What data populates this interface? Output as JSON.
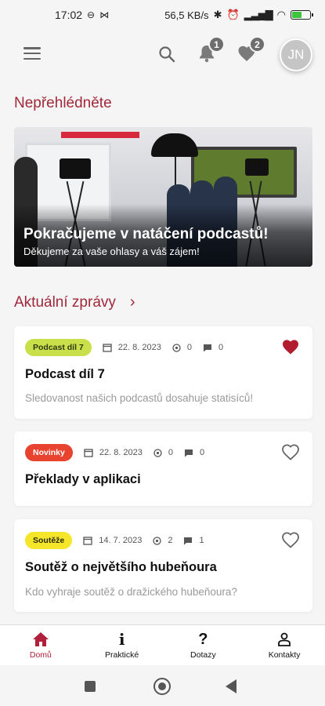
{
  "status_bar": {
    "time": "17:02",
    "network_speed": "56,5 KB/s",
    "battery_level": 0.55
  },
  "header": {
    "notifications_count": "1",
    "favorites_count": "2",
    "avatar_initials": "JN"
  },
  "featured": {
    "section_title": "Nepřehlédněte",
    "banner_title": "Pokračujeme v natáčení podcastů!",
    "banner_subtitle": "Děkujeme za vaše ohlasy a váš zájem!"
  },
  "news": {
    "section_title": "Aktuální zprávy",
    "items": [
      {
        "tag": "Podcast díl 7",
        "tag_color": "#c9e04a",
        "tag_text_color": "#2f3a12",
        "date": "22. 8. 2023",
        "views": "0",
        "comments": "0",
        "title": "Podcast díl 7",
        "description": "Sledovanost našich podcastů dosahuje statisíců!",
        "favorite": true
      },
      {
        "tag": "Novinky",
        "tag_color": "#e8432f",
        "tag_text_color": "#ffffff",
        "date": "22. 8. 2023",
        "views": "0",
        "comments": "0",
        "title": "Překlady v aplikaci",
        "description": "",
        "favorite": false
      },
      {
        "tag": "Soutěže",
        "tag_color": "#f5e62a",
        "tag_text_color": "#2b2a10",
        "date": "14. 7. 2023",
        "views": "2",
        "comments": "1",
        "title": "Soutěž o největšího hubeňoura",
        "description": "Kdo vyhraje soutěž o dražického hubeňoura?",
        "favorite": false
      }
    ]
  },
  "bottom_nav": [
    {
      "label": "Domů",
      "icon": "home-icon",
      "active": true
    },
    {
      "label": "Praktické",
      "icon": "info-icon",
      "active": false
    },
    {
      "label": "Dotazy",
      "icon": "question-icon",
      "active": false
    },
    {
      "label": "Kontakty",
      "icon": "contacts-icon",
      "active": false
    }
  ],
  "colors": {
    "accent": "#a1283a",
    "active_nav": "#b1203a",
    "favorite_active": "#b11c2e"
  }
}
